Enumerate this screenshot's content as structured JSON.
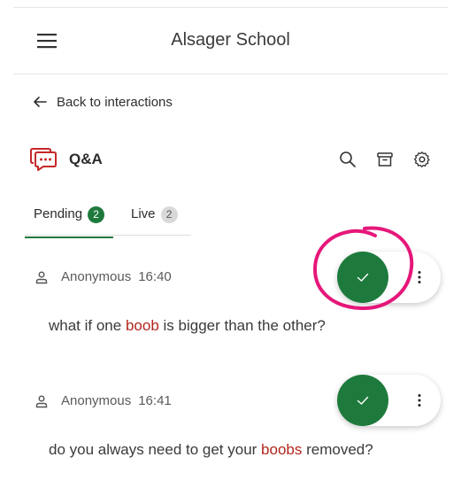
{
  "header": {
    "title": "Alsager School",
    "menu_icon": "hamburger-menu-icon"
  },
  "back_link": {
    "label": "Back to interactions",
    "icon": "arrow-left-icon"
  },
  "section": {
    "title": "Q&A",
    "icon": "chat-bubble-icon",
    "tools": [
      "search-icon",
      "archive-icon",
      "gear-icon"
    ]
  },
  "tabs": [
    {
      "label": "Pending",
      "count": "2",
      "active": true
    },
    {
      "label": "Live",
      "count": "2",
      "active": false
    }
  ],
  "questions": [
    {
      "author": "Anonymous",
      "time": "16:40",
      "text_before": "what if one ",
      "text_highlight": "boob",
      "text_after": " is bigger than the other?"
    },
    {
      "author": "Anonymous",
      "time": "16:41",
      "text_before": "do you always need to get your ",
      "text_highlight": "boobs",
      "text_after": " removed?"
    }
  ],
  "colors": {
    "accent_green": "#1e7a3c",
    "highlight_red": "#b3261e",
    "annotation_pink": "#e6177a"
  }
}
